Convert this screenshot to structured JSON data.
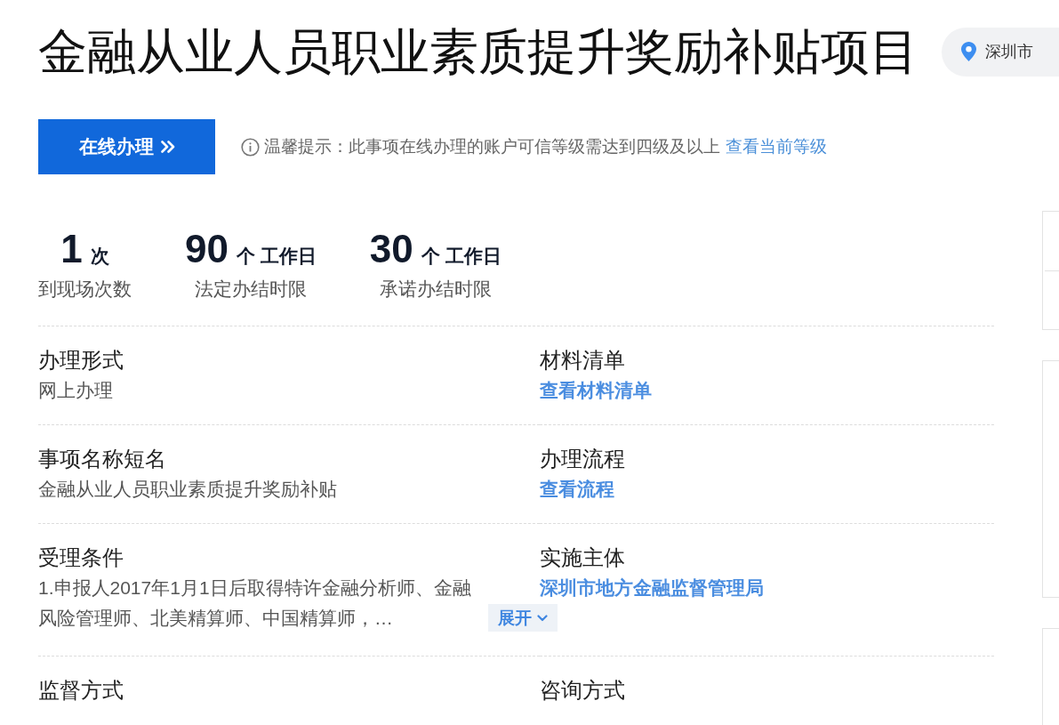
{
  "header": {
    "title": "金融从业人员职业素质提升奖励补贴项目",
    "location": "深圳市"
  },
  "actions": {
    "primary_button": "在线办理",
    "notice": {
      "text": "温馨提示：此事项在线办理的账户可信等级需达到四级及以上",
      "link": "查看当前等级"
    }
  },
  "stats": [
    {
      "value": "1",
      "unit": "次",
      "label": "到现场次数"
    },
    {
      "value": "90",
      "unit": "个 工作日",
      "label": "法定办结时限"
    },
    {
      "value": "30",
      "unit": "个 工作日",
      "label": "承诺办结时限"
    }
  ],
  "details": [
    {
      "label": "办理形式",
      "kind": "text",
      "value": "网上办理"
    },
    {
      "label": "材料清单",
      "kind": "link",
      "value": "查看材料清单"
    },
    {
      "label": "事项名称短名",
      "kind": "text",
      "value": "金融从业人员职业素质提升奖励补贴"
    },
    {
      "label": "办理流程",
      "kind": "link",
      "value": "查看流程"
    },
    {
      "label": "受理条件",
      "kind": "expandable",
      "value": "1.申报人2017年1月1日后取得特许金融分析师、金融风险管理师、北美精算师、中国精算师，…",
      "toggle": "展开",
      "expanded": false
    },
    {
      "label": "实施主体",
      "kind": "link",
      "value": "深圳市地方金融监督管理局"
    },
    {
      "label": "监督方式"
    },
    {
      "label": "咨询方式"
    }
  ]
}
